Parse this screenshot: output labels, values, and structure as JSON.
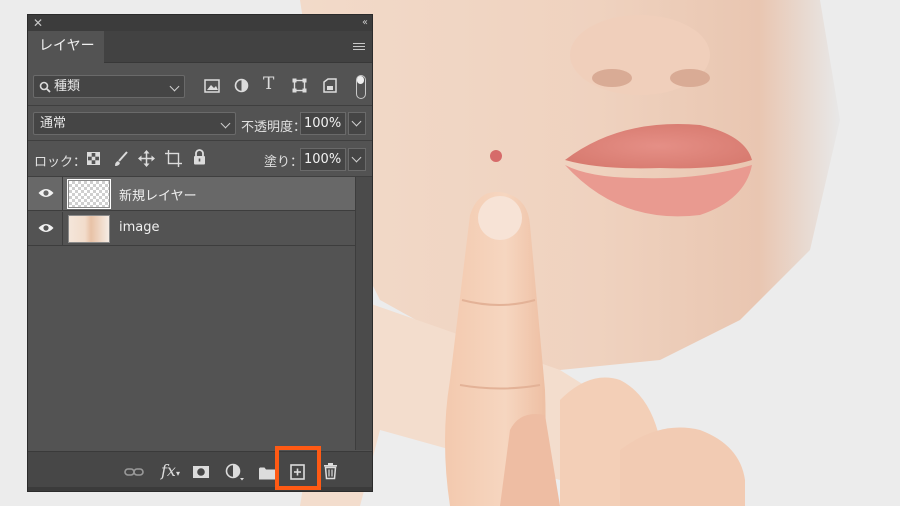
{
  "panel": {
    "tab_label": "レイヤー",
    "filter": {
      "label": "種類",
      "icons": [
        "search-icon",
        "image-filter-icon",
        "adjustment-filter-icon",
        "type-filter-icon",
        "shape-filter-icon",
        "smart-object-filter-icon"
      ]
    },
    "blend_mode": "通常",
    "opacity_label": "不透明度：",
    "opacity_value": "100%",
    "lock_label": "ロック：",
    "lock_icons": [
      "lock-transparent-icon",
      "lock-image-icon",
      "lock-position-icon",
      "lock-artboard-icon",
      "lock-all-icon"
    ],
    "fill_label": "塗り：",
    "fill_value": "100%",
    "layers": [
      {
        "name": "新規レイヤー",
        "selected": true,
        "thumbnail": "transparent"
      },
      {
        "name": "image",
        "selected": false,
        "thumbnail": "photo"
      }
    ],
    "bottom_icons": [
      "link-icon",
      "fx-icon",
      "mask-icon",
      "adjustment-layer-icon",
      "folder-icon",
      "new-layer-icon",
      "trash-icon"
    ],
    "highlight_color": "#ff5a14"
  }
}
